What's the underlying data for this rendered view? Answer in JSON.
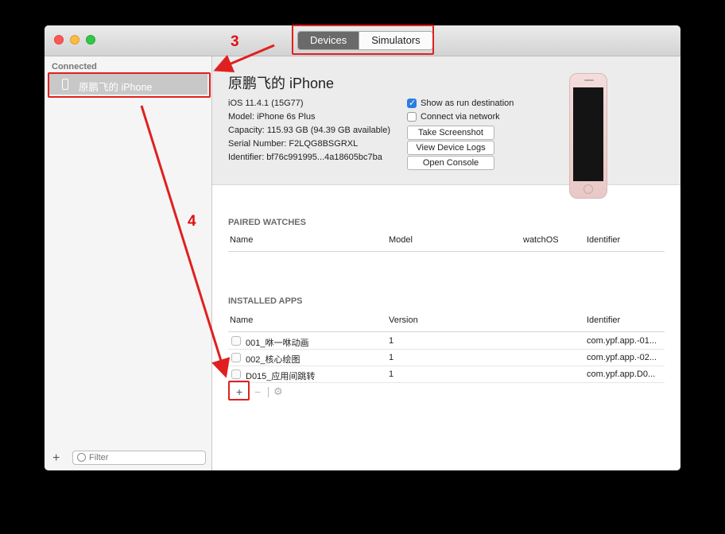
{
  "window": {
    "tabs": [
      {
        "label": "Devices",
        "active": true
      },
      {
        "label": "Simulators",
        "active": false
      }
    ]
  },
  "sidebar": {
    "section_title": "Connected",
    "device_label": "原鹏飞的 iPhone",
    "filter_placeholder": "Filter"
  },
  "device": {
    "name": "原鹏飞的 iPhone",
    "ios": "iOS 11.4.1 (15G77)",
    "model": "Model: iPhone 6s Plus",
    "capacity": "Capacity: 115.93 GB (94.39 GB available)",
    "serial": "Serial Number: F2LQG8BSGRXL",
    "identifier": "Identifier: bf76c991995...4a18605bc7ba",
    "show_run_destination": {
      "label": "Show as run destination",
      "checked": true
    },
    "connect_network": {
      "label": "Connect via network",
      "checked": false
    },
    "buttons": {
      "take_screenshot": "Take Screenshot",
      "view_logs": "View Device Logs",
      "open_console": "Open Console"
    }
  },
  "paired_watches": {
    "title": "PAIRED WATCHES",
    "columns": [
      "Name",
      "Model",
      "watchOS",
      "Identifier"
    ]
  },
  "installed_apps": {
    "title": "INSTALLED APPS",
    "columns": [
      "Name",
      "Version",
      "Identifier"
    ],
    "rows": [
      {
        "name": "001_咻一咻动画",
        "version": "1",
        "identifier": "com.ypf.app.-01..."
      },
      {
        "name": "002_核心绘图",
        "version": "1",
        "identifier": "com.ypf.app.-02..."
      },
      {
        "name": "D015_应用间跳转",
        "version": "1",
        "identifier": "com.ypf.app.D0..."
      }
    ]
  },
  "annotations": {
    "label_3": "3",
    "label_4": "4",
    "color": "#e02020"
  },
  "icons": [
    "phone-icon",
    "plus-icon",
    "filter-icon",
    "app-icon",
    "add-icon",
    "remove-icon",
    "gear-icon"
  ]
}
